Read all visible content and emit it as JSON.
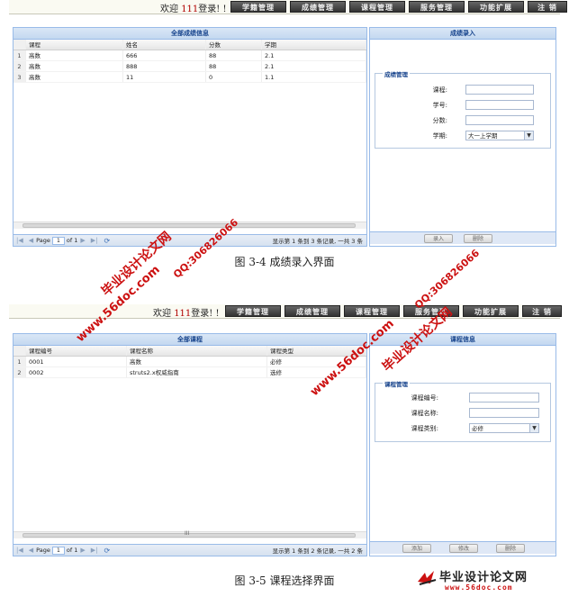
{
  "screens": [
    {
      "welcome": {
        "prefix": "欢迎",
        "user": "111",
        "suffix": "登录! !"
      },
      "menu": [
        "学籍管理",
        "成绩管理",
        "课程管理",
        "服务管理",
        "功能扩展",
        "注 销"
      ],
      "left_panel": {
        "title": "全部成绩信息",
        "columns": [
          "课程",
          "姓名",
          "分数",
          "学期"
        ],
        "rows": [
          {
            "n": "1",
            "cells": [
              "高数",
              "666",
              "88",
              "2.1"
            ]
          },
          {
            "n": "2",
            "cells": [
              "高数",
              "888",
              "88",
              "2.1"
            ]
          },
          {
            "n": "3",
            "cells": [
              "高数",
              "11",
              "0",
              "1.1"
            ]
          }
        ],
        "pager": {
          "page_label": "Page",
          "page_value": "1",
          "of_label": "of 1",
          "status": "显示第 1 条到 3 条记录, 一共 3 条"
        }
      },
      "right_panel": {
        "title": "成绩录入",
        "legend": "成绩管理",
        "fields": [
          {
            "label": "课程:",
            "value": ""
          },
          {
            "label": "学号:",
            "value": ""
          },
          {
            "label": "分数:",
            "value": ""
          }
        ],
        "select": {
          "label": "学期:",
          "value": "大一上学期"
        },
        "buttons": [
          "录入",
          "删除"
        ]
      },
      "caption": "图 3-4 成绩录入界面"
    },
    {
      "welcome": {
        "prefix": "欢迎",
        "user": "111",
        "suffix": "登录! !"
      },
      "menu": [
        "学籍管理",
        "成绩管理",
        "课程管理",
        "服务管理",
        "功能扩展",
        "注 销"
      ],
      "left_panel": {
        "title": "全部课程",
        "columns": [
          "课程编号",
          "课程名称",
          "课程类型"
        ],
        "rows": [
          {
            "n": "1",
            "cells": [
              "0001",
              "高数",
              "必修"
            ]
          },
          {
            "n": "2",
            "cells": [
              "0002",
              "struts2.x权威指南",
              "选修"
            ]
          }
        ],
        "pager": {
          "page_label": "Page",
          "page_value": "1",
          "of_label": "of 1",
          "status": "显示第 1 条到 2 条记录, 一共 2 条"
        }
      },
      "right_panel": {
        "title": "课程信息",
        "legend": "课程管理",
        "fields": [
          {
            "label": "课程编号:",
            "value": ""
          },
          {
            "label": "课程名称:",
            "value": ""
          }
        ],
        "select": {
          "label": "课程类别:",
          "value": "必修"
        },
        "buttons": [
          "添加",
          "修改",
          "删除"
        ]
      },
      "caption": "图 3-5 课程选择界面"
    }
  ],
  "watermarks": {
    "site_cn": "毕业设计论文网",
    "site_url": "www.56doc.com",
    "qq": "QQ:306826066"
  },
  "logo": {
    "text": "毕业设计论文网",
    "url": "www.56doc.com"
  },
  "colors": {
    "panel_border": "#99bbe8",
    "panel_title": "#15428b",
    "watermark": "#cc1111",
    "menu_bg": "#444444"
  }
}
